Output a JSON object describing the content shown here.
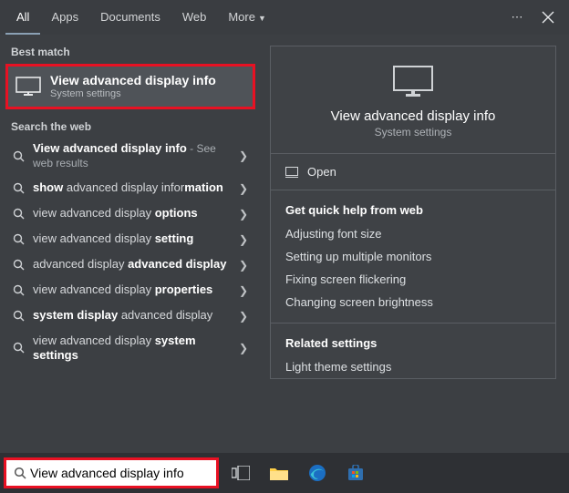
{
  "tabs": {
    "all": "All",
    "apps": "Apps",
    "documents": "Documents",
    "web": "Web",
    "more": "More"
  },
  "left": {
    "best_match_label": "Best match",
    "best_match": {
      "title": "View advanced display info",
      "subtitle": "System settings"
    },
    "search_web_label": "Search the web",
    "web_results": [
      {
        "prefix": "",
        "bold1": "View advanced display info",
        "mid": "",
        "bold2": "",
        "suffix": "",
        "trail": " - See web results"
      },
      {
        "prefix": "",
        "bold1": "show",
        "mid": " advanced display infor",
        "bold2": "mation",
        "suffix": "",
        "trail": ""
      },
      {
        "prefix": "view advanced display ",
        "bold1": "options",
        "mid": "",
        "bold2": "",
        "suffix": "",
        "trail": ""
      },
      {
        "prefix": "view advanced display ",
        "bold1": "setting",
        "mid": "",
        "bold2": "",
        "suffix": "",
        "trail": ""
      },
      {
        "prefix": "advanced display ",
        "bold1": "advanced display",
        "mid": "",
        "bold2": "",
        "suffix": "",
        "trail": ""
      },
      {
        "prefix": "view advanced display ",
        "bold1": "properties",
        "mid": "",
        "bold2": "",
        "suffix": "",
        "trail": ""
      },
      {
        "prefix": "",
        "bold1": "system display",
        "mid": " advanced display",
        "bold2": "",
        "suffix": "",
        "trail": ""
      },
      {
        "prefix": "view advanced display ",
        "bold1": "system settings",
        "mid": "",
        "bold2": "",
        "suffix": "",
        "trail": ""
      }
    ]
  },
  "preview": {
    "title": "View advanced display info",
    "subtitle": "System settings",
    "open_label": "Open",
    "quick_help_label": "Get quick help from web",
    "quick_links": [
      "Adjusting font size",
      "Setting up multiple monitors",
      "Fixing screen flickering",
      "Changing screen brightness"
    ],
    "related_label": "Related settings",
    "related_links": [
      "Light theme settings"
    ]
  },
  "searchbox": {
    "value": "View advanced display info"
  }
}
